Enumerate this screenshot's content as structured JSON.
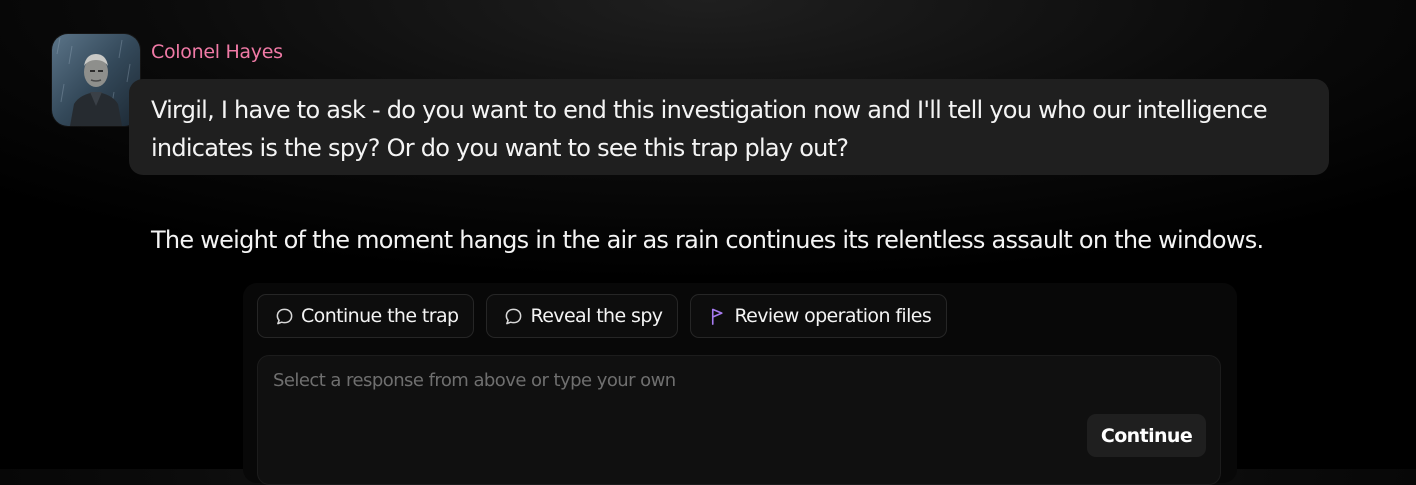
{
  "speaker": {
    "name": "Colonel Hayes",
    "name_color": "#f07aa6"
  },
  "message": {
    "text": "Virgil, I have to ask - do you want to end this investigation now and I'll tell you who our intelligence indicates is the spy? Or do you want to see this trap play out?"
  },
  "narration": {
    "text": "The weight of the moment hangs in the air as rain continues its relentless assault on the windows."
  },
  "suggestions": [
    {
      "label": "Continue the trap",
      "icon": "chat-bubble-icon"
    },
    {
      "label": "Reveal the spy",
      "icon": "chat-bubble-icon"
    },
    {
      "label": "Review operation files",
      "icon": "flag-icon",
      "icon_color": "#a77bf0"
    }
  ],
  "composer": {
    "placeholder": "Select a response from above or type your own",
    "value": "",
    "submit_label": "Continue"
  }
}
